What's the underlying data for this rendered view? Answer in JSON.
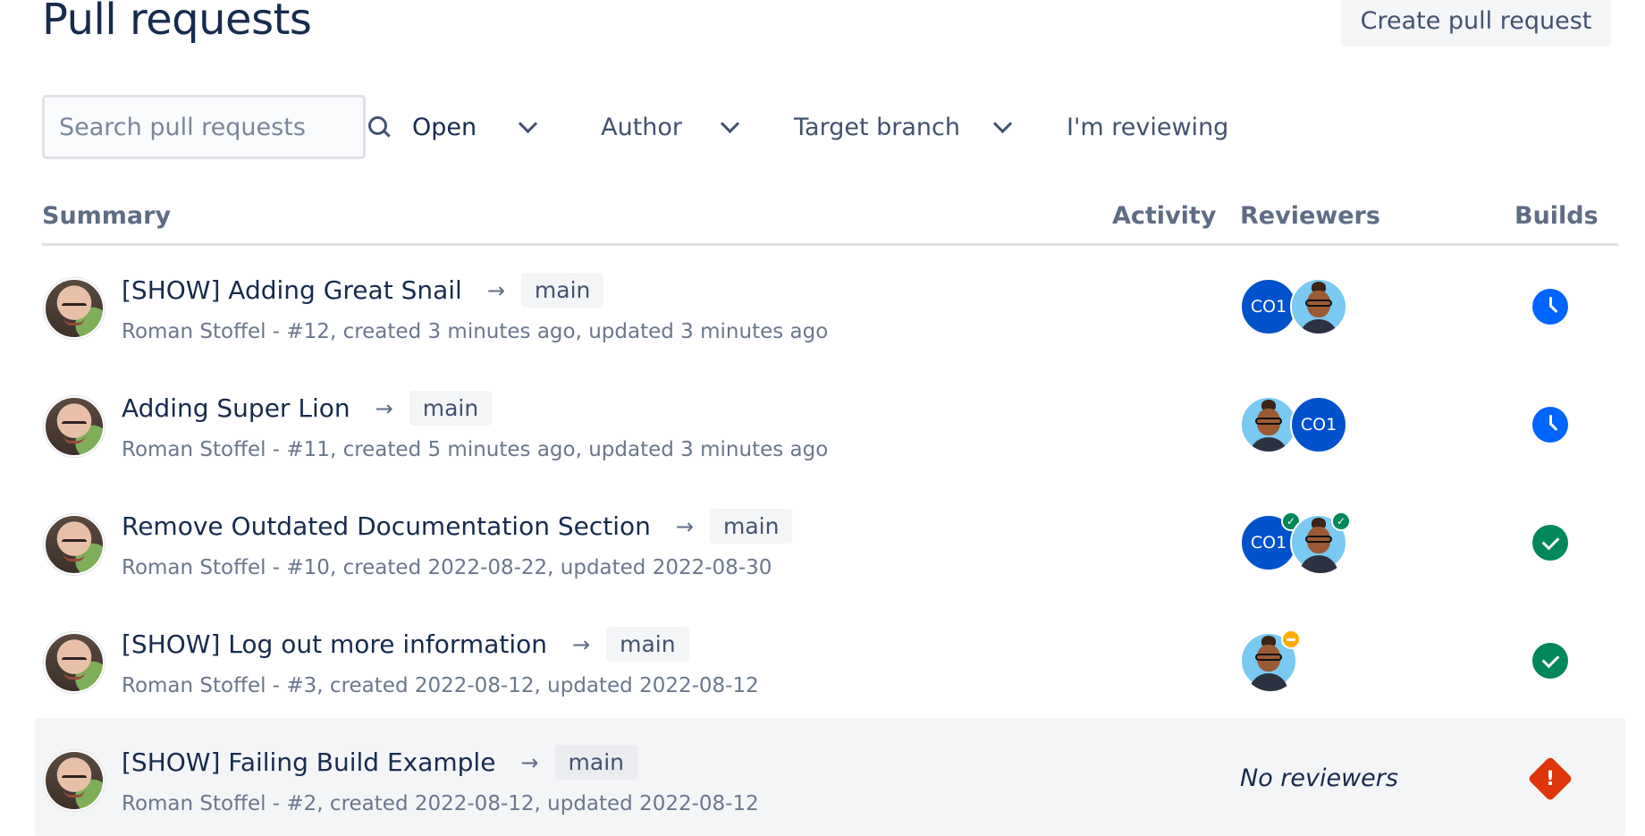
{
  "page": {
    "title": "Pull requests"
  },
  "header": {
    "create_button": "Create pull request"
  },
  "filters": {
    "search_placeholder": "Search pull requests",
    "state": "Open",
    "author": "Author",
    "target_branch": "Target branch",
    "reviewing": "I'm reviewing"
  },
  "table": {
    "columns": [
      "Summary",
      "Activity",
      "Reviewers",
      "Builds"
    ],
    "arrow": "→",
    "no_reviewers": "No reviewers",
    "rows": [
      {
        "title": "[SHOW] Adding Great Snail",
        "branch": "main",
        "meta": "Roman Stoffel - #12, created 3 minutes ago, updated 3 minutes ago",
        "build": "in-progress"
      },
      {
        "title": "Adding Super Lion",
        "branch": "main",
        "meta": "Roman Stoffel - #11, created 5 minutes ago, updated 3 minutes ago",
        "build": "in-progress"
      },
      {
        "title": "Remove Outdated Documentation Section",
        "branch": "main",
        "meta": "Roman Stoffel - #10, created 2022-08-22, updated 2022-08-30",
        "build": "success"
      },
      {
        "title": "[SHOW] Log out more information",
        "branch": "main",
        "meta": "Roman Stoffel - #3, created 2022-08-12, updated 2022-08-12",
        "build": "success"
      },
      {
        "title": "[SHOW] Failing Build Example",
        "branch": "main",
        "meta": "Roman Stoffel - #2, created 2022-08-12, updated 2022-08-12",
        "build": "failed"
      }
    ],
    "reviewer_initials": "CO1"
  },
  "colors": {
    "brand_blue": "#0052cc",
    "success": "#00875a",
    "error": "#de350b",
    "warning": "#ffab00"
  }
}
